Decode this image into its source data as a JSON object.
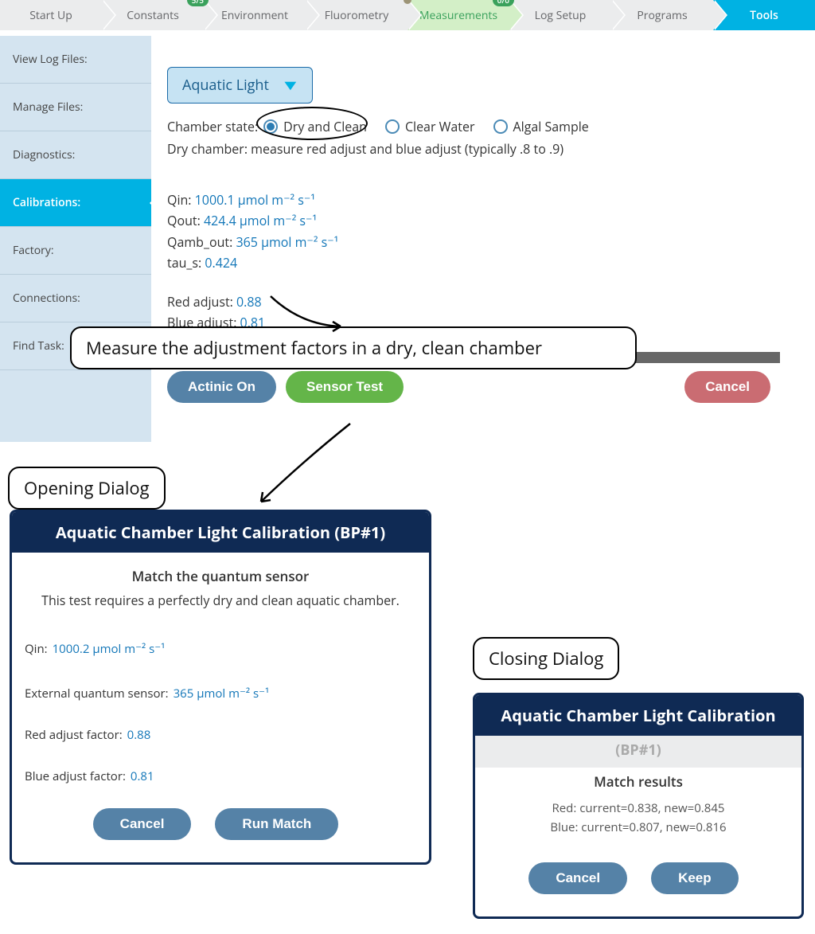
{
  "nav": {
    "tabs": [
      "Start Up",
      "Constants",
      "Environment",
      "Fluorometry",
      "Measurements",
      "Log Setup",
      "Programs",
      "Tools"
    ],
    "badges": {
      "constants": "5/5",
      "measurements": "0/0"
    },
    "active": "Tools",
    "greenTab": "Measurements",
    "dotTab": "Fluorometry"
  },
  "sidebar": {
    "items": [
      "View Log Files:",
      "Manage Files:",
      "Diagnostics:",
      "Calibrations:",
      "Factory:",
      "Connections:",
      "Find Task:"
    ],
    "active": "Calibrations:"
  },
  "dropdown": {
    "label": "Aquatic Light"
  },
  "chamber": {
    "label": "Chamber state:",
    "options": [
      "Dry and Clean",
      "Clear Water",
      "Algal Sample"
    ],
    "selected": "Dry and Clean",
    "hint": "Dry chamber: measure red adjust and blue adjust (typically .8 to .9)"
  },
  "stats": {
    "qin": {
      "label": "Qin:",
      "value": "1000.1",
      "unit": "µmol m⁻² s⁻¹"
    },
    "qout": {
      "label": "Qout:",
      "value": "424.4",
      "unit": "µmol m⁻² s⁻¹"
    },
    "qamb": {
      "label": "Qamb_out:",
      "value": "365",
      "unit": "µmol m⁻² s⁻¹"
    },
    "tau": {
      "label": "tau_s:",
      "value": "0.424"
    },
    "red": {
      "label": "Red adjust:",
      "value": "0.88"
    },
    "blue": {
      "label": "Blue adjust:",
      "value": "0.81"
    }
  },
  "buttons": {
    "actinic": "Actinic On",
    "sensor": "Sensor Test",
    "cancel": "Cancel"
  },
  "annot": {
    "main": "Measure the adjustment factors in a dry, clean chamber",
    "open": "Opening Dialog",
    "close": "Closing Dialog"
  },
  "dlg1": {
    "title": "Aquatic Chamber Light Calibration (BP#1)",
    "sub": "Match the quantum sensor",
    "note": "This test requires a perfectly dry and clean aquatic chamber.",
    "qin": {
      "label": "Qin:",
      "value": "1000.2",
      "unit": "µmol m⁻² s⁻¹"
    },
    "ext": {
      "label": "External quantum sensor:",
      "value": "365",
      "unit": "µmol m⁻² s⁻¹"
    },
    "red": {
      "label": "Red adjust factor:",
      "value": "0.88"
    },
    "blue": {
      "label": "Blue adjust factor:",
      "value": "0.81"
    },
    "cancel": "Cancel",
    "run": "Run Match"
  },
  "dlg2": {
    "title": "Aquatic Chamber Light Calibration",
    "subtitle": "(BP#1)",
    "heading": "Match results",
    "redline": "Red: current=0.838, new=0.845",
    "blueline": "Blue: current=0.807, new=0.816",
    "cancel": "Cancel",
    "keep": "Keep"
  }
}
